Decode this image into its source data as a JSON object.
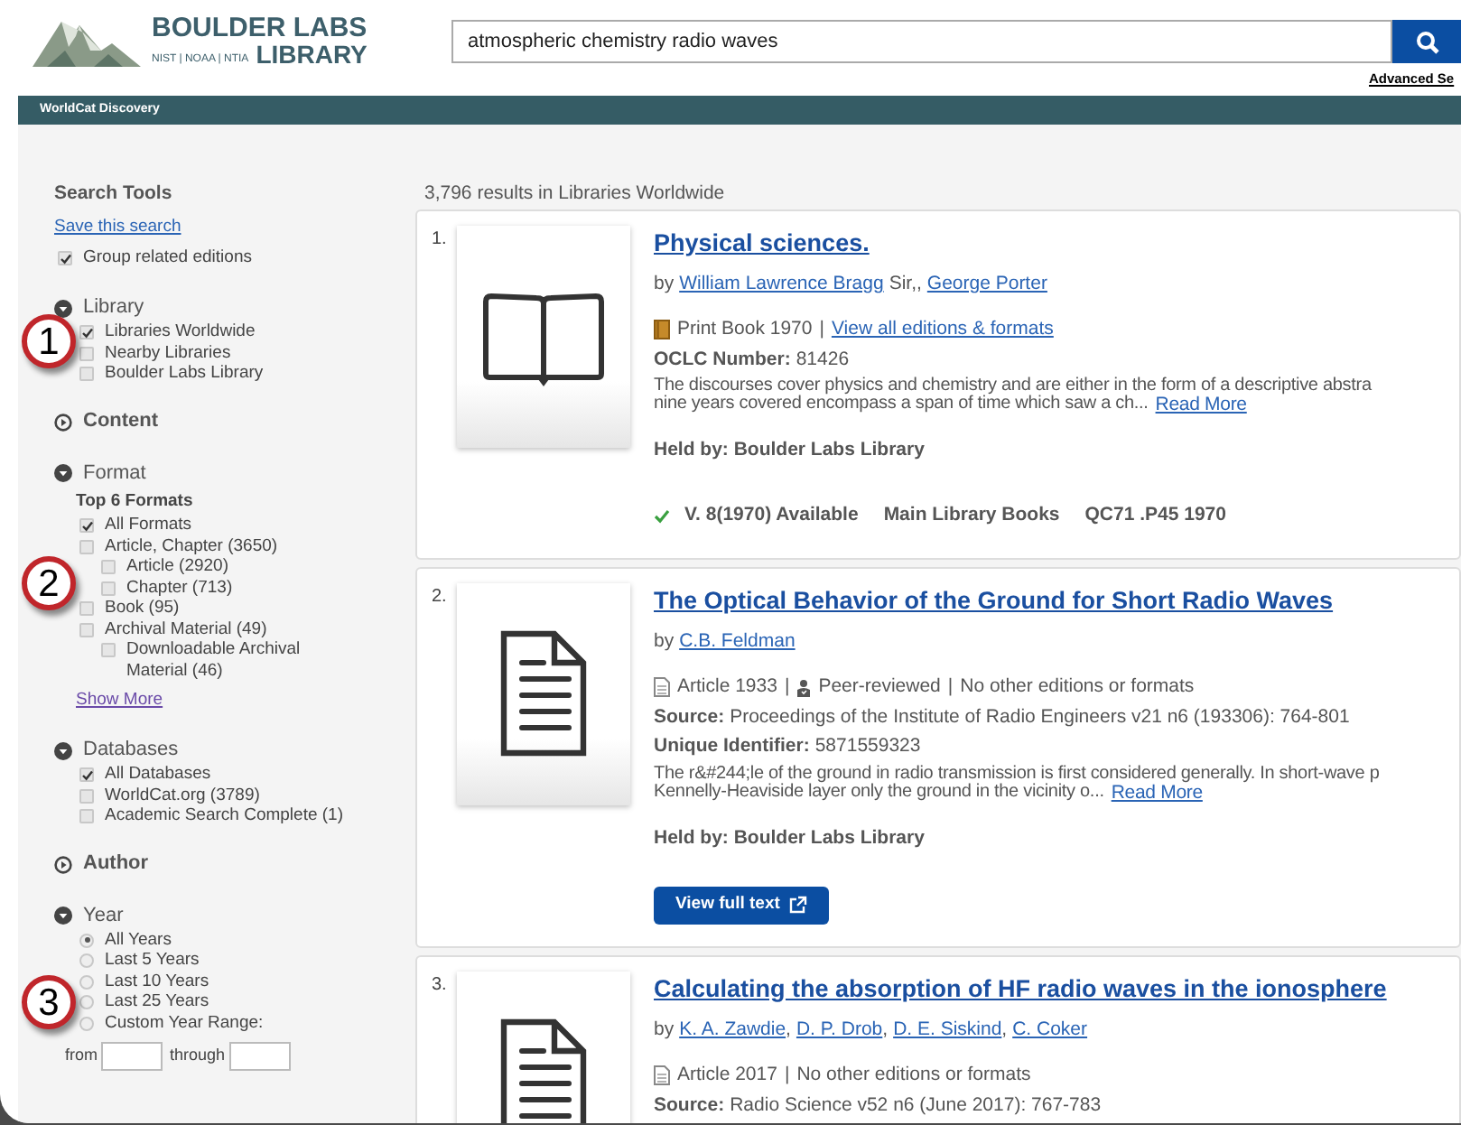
{
  "logo": {
    "name_top": "BOULDER LABS",
    "name_bottom": "LIBRARY",
    "agencies": "NIST | NOAA | NTIA"
  },
  "search": {
    "value": "atmospheric chemistry radio waves",
    "advanced_link": "Advanced Se"
  },
  "nav_bar": {
    "title": "WorldCat Discovery"
  },
  "sidebar": {
    "title": "Search Tools",
    "save_link": "Save this search",
    "group_option": {
      "label": "Group related editions",
      "checked": true
    },
    "facets": [
      {
        "title": "Library",
        "expanded": true,
        "options": [
          {
            "kind": "checkbox",
            "label": "Libraries Worldwide",
            "checked": true
          },
          {
            "kind": "checkbox",
            "label": "Nearby Libraries",
            "checked": false
          },
          {
            "kind": "checkbox",
            "label": "Boulder Labs Library",
            "checked": false
          }
        ]
      },
      {
        "title": "Content",
        "expanded": false
      },
      {
        "title": "Format",
        "expanded": true,
        "subtitle": "Top 6 Formats",
        "options": [
          {
            "kind": "checkbox",
            "label": "All Formats",
            "checked": true
          },
          {
            "kind": "checkbox",
            "label": "Article, Chapter (3650)",
            "checked": false,
            "children": [
              {
                "kind": "checkbox",
                "label": "Article (2920)",
                "checked": false
              },
              {
                "kind": "checkbox",
                "label": "Chapter (713)",
                "checked": false
              }
            ]
          },
          {
            "kind": "checkbox",
            "label": "Book (95)",
            "checked": false
          },
          {
            "kind": "checkbox",
            "label": "Archival Material (49)",
            "checked": false,
            "children": [
              {
                "kind": "checkbox",
                "label": "Downloadable Archival Material (46)",
                "checked": false
              }
            ]
          }
        ],
        "more_link": "Show More"
      },
      {
        "title": "Databases",
        "expanded": true,
        "options": [
          {
            "kind": "checkbox",
            "label": "All Databases",
            "checked": true
          },
          {
            "kind": "checkbox",
            "label": "WorldCat.org (3789)",
            "checked": false
          },
          {
            "kind": "checkbox",
            "label": "Academic Search Complete (1)",
            "checked": false
          }
        ]
      },
      {
        "title": "Author",
        "expanded": false
      },
      {
        "title": "Year",
        "expanded": true,
        "options": [
          {
            "kind": "radio",
            "label": "All Years",
            "selected": true
          },
          {
            "kind": "radio",
            "label": "Last 5 Years",
            "selected": false
          },
          {
            "kind": "radio",
            "label": "Last 10 Years",
            "selected": false
          },
          {
            "kind": "radio",
            "label": "Last 25 Years",
            "selected": false
          },
          {
            "kind": "radio",
            "label": "Custom Year Range:",
            "selected": false
          }
        ],
        "range": {
          "from_label": "from",
          "through_label": "through"
        }
      }
    ]
  },
  "callouts": [
    {
      "number": "1"
    },
    {
      "number": "2"
    },
    {
      "number": "3"
    }
  ],
  "results_summary": "3,796 results in Libraries Worldwide",
  "results": [
    {
      "number": "1.",
      "thumbnail": {
        "kind": "book"
      },
      "title": "Physical sciences.",
      "by_label": "by",
      "authors": [
        {
          "name": "William Lawrence Bragg",
          "after": "Sir,,"
        },
        {
          "name": "George Porter"
        }
      ],
      "format": {
        "kind": "book",
        "parts": [
          {
            "kind": "text",
            "text": "Print Book 1970"
          },
          {
            "kind": "separator",
            "text": "|"
          },
          {
            "kind": "link",
            "text": "View all editions & formats"
          }
        ]
      },
      "fields": [
        {
          "label": "OCLC Number:",
          "value": "81426"
        }
      ],
      "description": [
        "The discourses cover physics and chemistry and are either in the form of a descriptive abstra",
        "nine years covered encompass a span of time which saw a ch..."
      ],
      "read_more": "Read More",
      "held_by": "Held by: Boulder Labs Library",
      "availability": {
        "status": "V. 8(1970) Available",
        "location": "Main Library Books",
        "call_number": "QC71 .P45 1970"
      }
    },
    {
      "number": "2.",
      "thumbnail": {
        "kind": "document"
      },
      "title": "The Optical Behavior of the Ground for Short Radio Waves",
      "by_label": "by",
      "authors": [
        {
          "name": "C.B. Feldman"
        }
      ],
      "format": {
        "kind": "document",
        "parts": [
          {
            "kind": "text",
            "text": "Article 1933"
          },
          {
            "kind": "separator",
            "text": "|"
          },
          {
            "kind": "reviewed",
            "text": "Peer-reviewed"
          },
          {
            "kind": "separator",
            "text": "|"
          },
          {
            "kind": "text",
            "text": "No other editions or formats"
          }
        ]
      },
      "fields": [
        {
          "label": "Source:",
          "value": "Proceedings of the Institute of Radio Engineers v21 n6 (193306): 764-801"
        },
        {
          "label": "Unique Identifier:",
          "value": "5871559323"
        }
      ],
      "description": [
        "The r&#244;le of the ground in radio transmission is first considered generally. In short-wave p",
        "Kennelly-Heaviside layer only the ground in the vicinity o..."
      ],
      "read_more": "Read More",
      "held_by": "Held by: Boulder Labs Library",
      "button": "View full text"
    },
    {
      "number": "3.",
      "thumbnail": {
        "kind": "document"
      },
      "title": "Calculating the absorption of HF radio waves in the ionosphere",
      "by_label": "by",
      "authors": [
        {
          "name": "K. A. Zawdie",
          "after": ","
        },
        {
          "name": "D. P. Drob",
          "after": ","
        },
        {
          "name": "D. E. Siskind",
          "after": ","
        },
        {
          "name": "C. Coker"
        }
      ],
      "format": {
        "kind": "document",
        "parts": [
          {
            "kind": "text",
            "text": "Article 2017"
          },
          {
            "kind": "separator",
            "text": "|"
          },
          {
            "kind": "text",
            "text": "No other editions or formats"
          }
        ]
      },
      "fields": [
        {
          "label": "Source:",
          "value": "Radio Science v52 n6 (June 2017): 767-783"
        }
      ]
    }
  ]
}
